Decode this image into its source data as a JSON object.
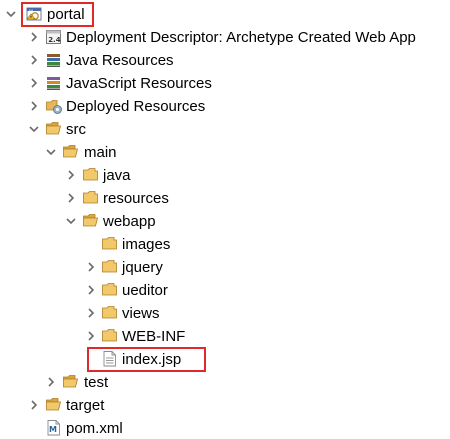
{
  "tree": {
    "project": {
      "label": "portal",
      "icon": "maven-web-project-icon",
      "expanded": true,
      "highlighted": true
    },
    "items": [
      {
        "label": "Deployment Descriptor: Archetype Created Web App",
        "icon": "deployment-descriptor-icon",
        "expanded": false
      },
      {
        "label": "Java Resources",
        "icon": "java-resources-icon",
        "expanded": false
      },
      {
        "label": "JavaScript Resources",
        "icon": "javascript-resources-icon",
        "expanded": false
      },
      {
        "label": "Deployed Resources",
        "icon": "deployed-resources-icon",
        "expanded": false
      },
      {
        "label": "src",
        "icon": "folder-icon",
        "expanded": true,
        "children": [
          {
            "label": "main",
            "icon": "folder-icon",
            "expanded": true,
            "children": [
              {
                "label": "java",
                "icon": "folder-icon",
                "expanded": false
              },
              {
                "label": "resources",
                "icon": "folder-icon",
                "expanded": false
              },
              {
                "label": "webapp",
                "icon": "folder-icon",
                "expanded": true,
                "children": [
                  {
                    "label": "images",
                    "icon": "folder-icon"
                  },
                  {
                    "label": "jquery",
                    "icon": "folder-icon",
                    "expanded": false
                  },
                  {
                    "label": "ueditor",
                    "icon": "folder-icon",
                    "expanded": false
                  },
                  {
                    "label": "views",
                    "icon": "folder-icon",
                    "expanded": false
                  },
                  {
                    "label": "WEB-INF",
                    "icon": "folder-icon",
                    "expanded": false
                  },
                  {
                    "label": "index.jsp",
                    "icon": "jsp-file-icon",
                    "highlighted": true
                  }
                ]
              }
            ]
          },
          {
            "label": "test",
            "icon": "folder-icon",
            "expanded": false
          }
        ]
      },
      {
        "label": "target",
        "icon": "folder-icon",
        "expanded": false
      },
      {
        "label": "pom.xml",
        "icon": "xml-file-icon"
      }
    ]
  },
  "colors": {
    "highlight_border": "#e02a2a",
    "folder": "#e8b55a",
    "twistie": "#6b6b6b"
  }
}
